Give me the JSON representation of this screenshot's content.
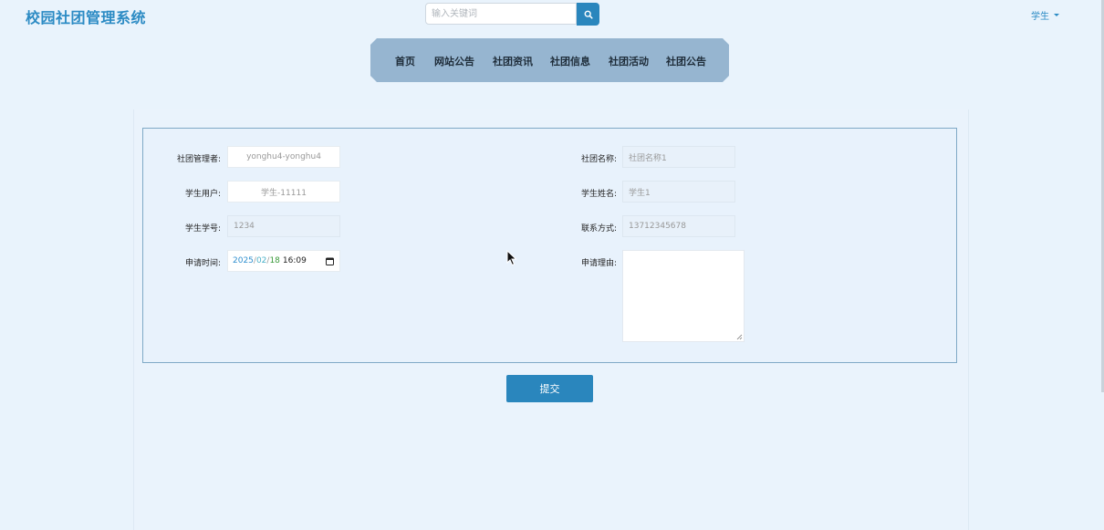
{
  "header": {
    "site_title": "校园社团管理系统",
    "search_placeholder": "输入关键词",
    "user_label": "学生"
  },
  "nav": {
    "items": [
      "首页",
      "网站公告",
      "社团资讯",
      "社团信息",
      "社团活动",
      "社团公告"
    ]
  },
  "form": {
    "manager_label": "社团管理者:",
    "manager_value": "yonghu4-yonghu4",
    "club_name_label": "社团名称:",
    "club_name_value": "社团名称1",
    "student_user_label": "学生用户:",
    "student_user_value": "学生-11111",
    "student_name_label": "学生姓名:",
    "student_name_value": "学生1",
    "student_no_label": "学生学号:",
    "student_no_value": "1234",
    "contact_label": "联系方式:",
    "contact_value": "13712345678",
    "apply_time_label": "申请时间:",
    "apply_time_year": "2025",
    "apply_time_month": "02",
    "apply_time_day": "18",
    "apply_time_clock": "16:09",
    "reason_label": "申请理由:",
    "reason_value": ""
  },
  "actions": {
    "submit_label": "提交"
  },
  "colors": {
    "accent": "#2a86bd",
    "title": "#2c8bc4",
    "nav_bg": "#96b5d0",
    "page_bg": "#e9f3fc"
  }
}
